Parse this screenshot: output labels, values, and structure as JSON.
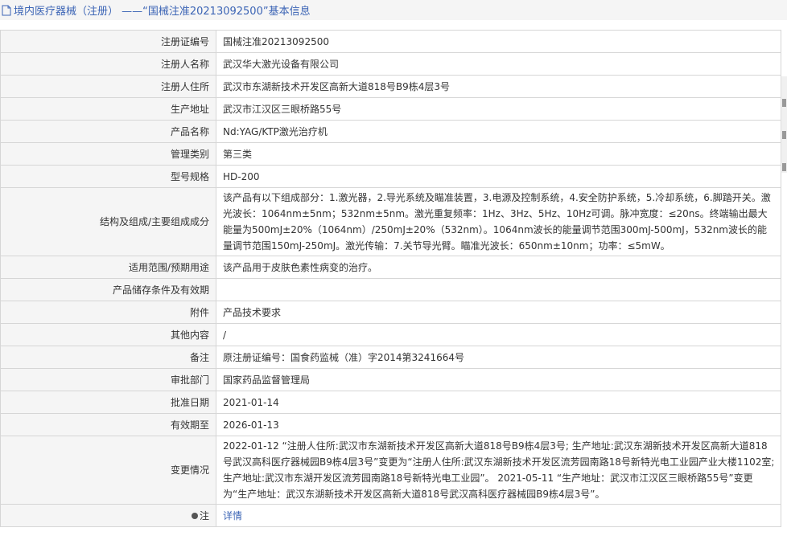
{
  "header": {
    "title": "境内医疗器械（注册） ——“国械注准20213092500”基本信息"
  },
  "rows": [
    {
      "label": "注册证编号",
      "value": "国械注准20213092500"
    },
    {
      "label": "注册人名称",
      "value": "武汉华大激光设备有限公司"
    },
    {
      "label": "注册人住所",
      "value": "武汉市东湖新技术开发区高新大道818号B9栋4层3号"
    },
    {
      "label": "生产地址",
      "value": "武汉市江汉区三眼桥路55号"
    },
    {
      "label": "产品名称",
      "value": "Nd:YAG/KTP激光治疗机"
    },
    {
      "label": "管理类别",
      "value": "第三类"
    },
    {
      "label": "型号规格",
      "value": "HD-200"
    },
    {
      "label": "结构及组成/主要组成成分",
      "value": "该产品有以下组成部分：1.激光器，2.导光系统及瞄准装置，3.电源及控制系统，4.安全防护系统，5.冷却系统，6.脚踏开关。激光波长：1064nm±5nm；532nm±5nm。激光重复频率：1Hz、3Hz、5Hz、10Hz可调。脉冲宽度：≤20ns。终端输出最大能量为500mJ±20%（1064nm）/250mJ±20%（532nm）。1064nm波长的能量调节范围300mJ-500mJ，532nm波长的能量调节范围150mJ-250mJ。激光传输：7.关节导光臂。瞄准光波长：650nm±10nm；功率：≤5mW。"
    },
    {
      "label": "适用范围/预期用途",
      "value": "该产品用于皮肤色素性病变的治疗。"
    },
    {
      "label": "产品储存条件及有效期",
      "value": ""
    },
    {
      "label": "附件",
      "value": "产品技术要求"
    },
    {
      "label": "其他内容",
      "value": "/"
    },
    {
      "label": "备注",
      "value": "原注册证编号：国食药监械（准）字2014第3241664号"
    },
    {
      "label": "审批部门",
      "value": "国家药品监督管理局"
    },
    {
      "label": "批准日期",
      "value": "2021-01-14"
    },
    {
      "label": "有效期至",
      "value": "2026-01-13"
    },
    {
      "label": "变更情况",
      "value": "2022-01-12 “注册人住所:武汉市东湖新技术开发区高新大道818号B9栋4层3号; 生产地址:武汉东湖新技术开发区高新大道818号武汉高科医疗器械园B9栋4层3号”变更为“注册人住所:武汉东湖新技术开发区流芳园南路18号新特光电工业园产业大楼1102室; 生产地址:武汉市东湖开发区流芳园南路18号新特光电工业园”。 2021-05-11 “生产地址：武汉市江汉区三眼桥路55号”变更为“生产地址：武汉东湖新技术开发区高新大道818号武汉高科医疗器械园B9栋4层3号”。"
    },
    {
      "label": "注",
      "value": "详情"
    }
  ],
  "icons": {
    "header": "document-icon",
    "note": "lightbulb-icon"
  }
}
